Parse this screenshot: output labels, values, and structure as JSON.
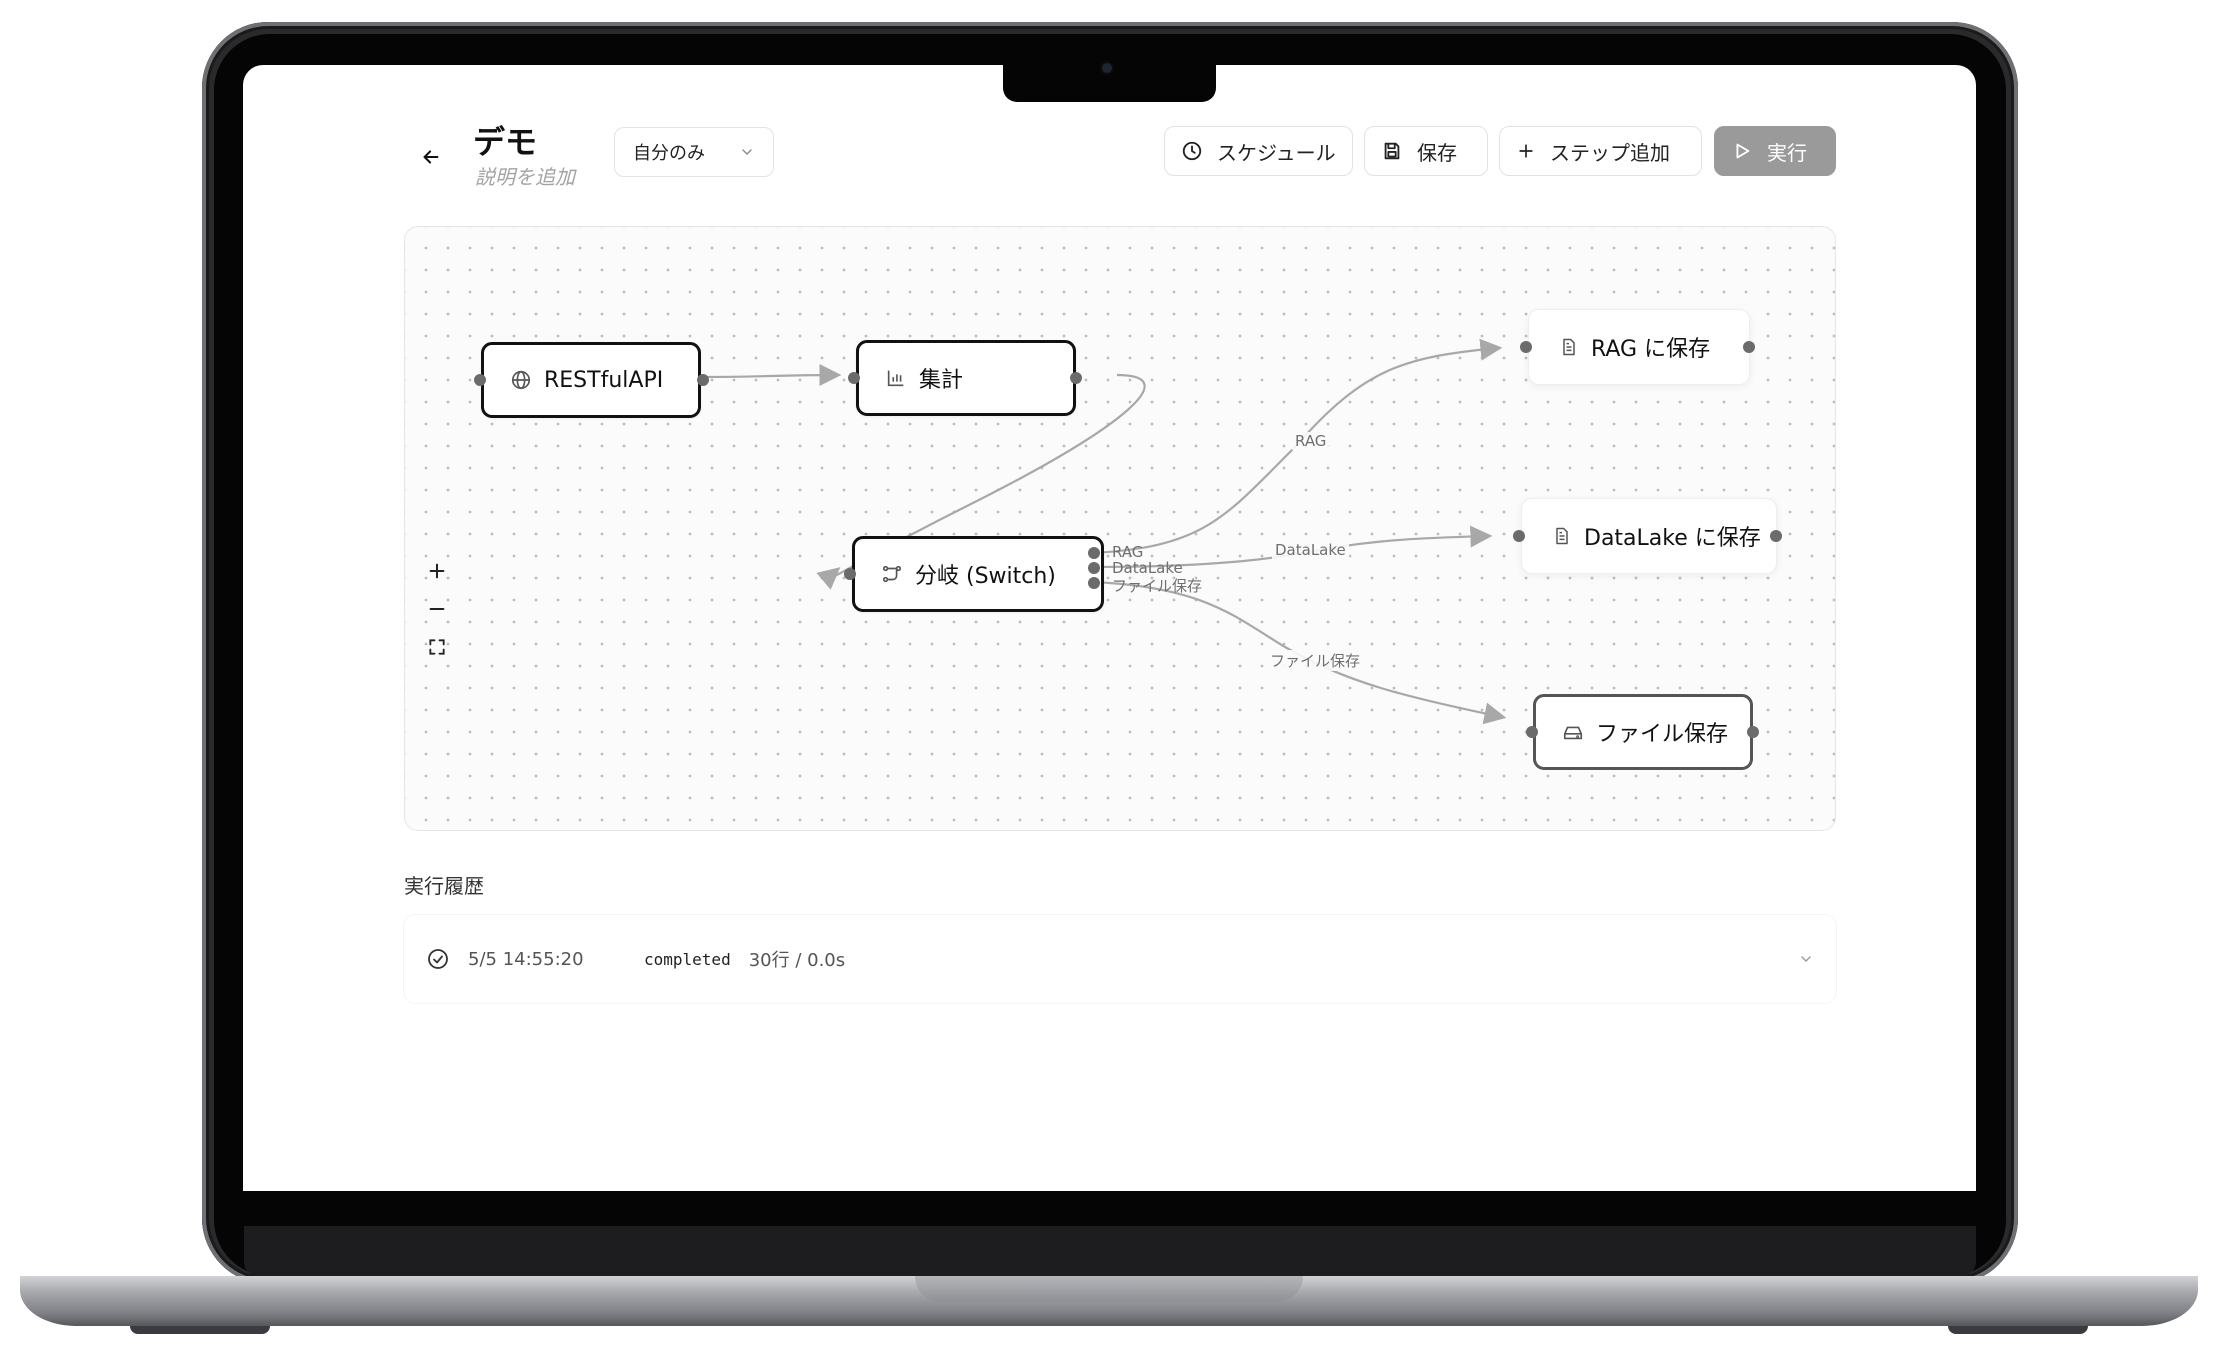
{
  "header": {
    "title": "デモ",
    "subtitle": "説明を追加",
    "visibility": "自分のみ"
  },
  "toolbar": {
    "schedule_label": "スケジュール",
    "save_label": "保存",
    "add_step_label": "ステップ追加",
    "run_label": "実行"
  },
  "workflow": {
    "nodes": {
      "restful": {
        "label": "RESTfulAPI",
        "icon": "globe-icon"
      },
      "aggregate": {
        "label": "集計",
        "icon": "bar-chart-icon"
      },
      "switch": {
        "label": "分岐 (Switch)",
        "icon": "split-icon"
      },
      "rag": {
        "label": "RAG に保存",
        "icon": "file-icon"
      },
      "datalake": {
        "label": "DataLake に保存",
        "icon": "file-icon"
      },
      "file": {
        "label": "ファイル保存",
        "icon": "drive-icon"
      }
    },
    "ports": [
      "RAG",
      "DataLake",
      "ファイル保存"
    ],
    "edge_labels": {
      "rag": "RAG",
      "datalake": "DataLake",
      "file": "ファイル保存"
    }
  },
  "zoom_controls": {
    "zoom_in": "+",
    "zoom_out": "−"
  },
  "history": {
    "heading": "実行履歴",
    "rows": [
      {
        "timestamp": "5/5 14:55:20",
        "status": "completed",
        "summary": "30行 / 0.0s"
      }
    ]
  },
  "colors": {
    "run_button": "#9a9a9a",
    "edge": "#a8a8a8",
    "handle": "#6b6b6b"
  }
}
